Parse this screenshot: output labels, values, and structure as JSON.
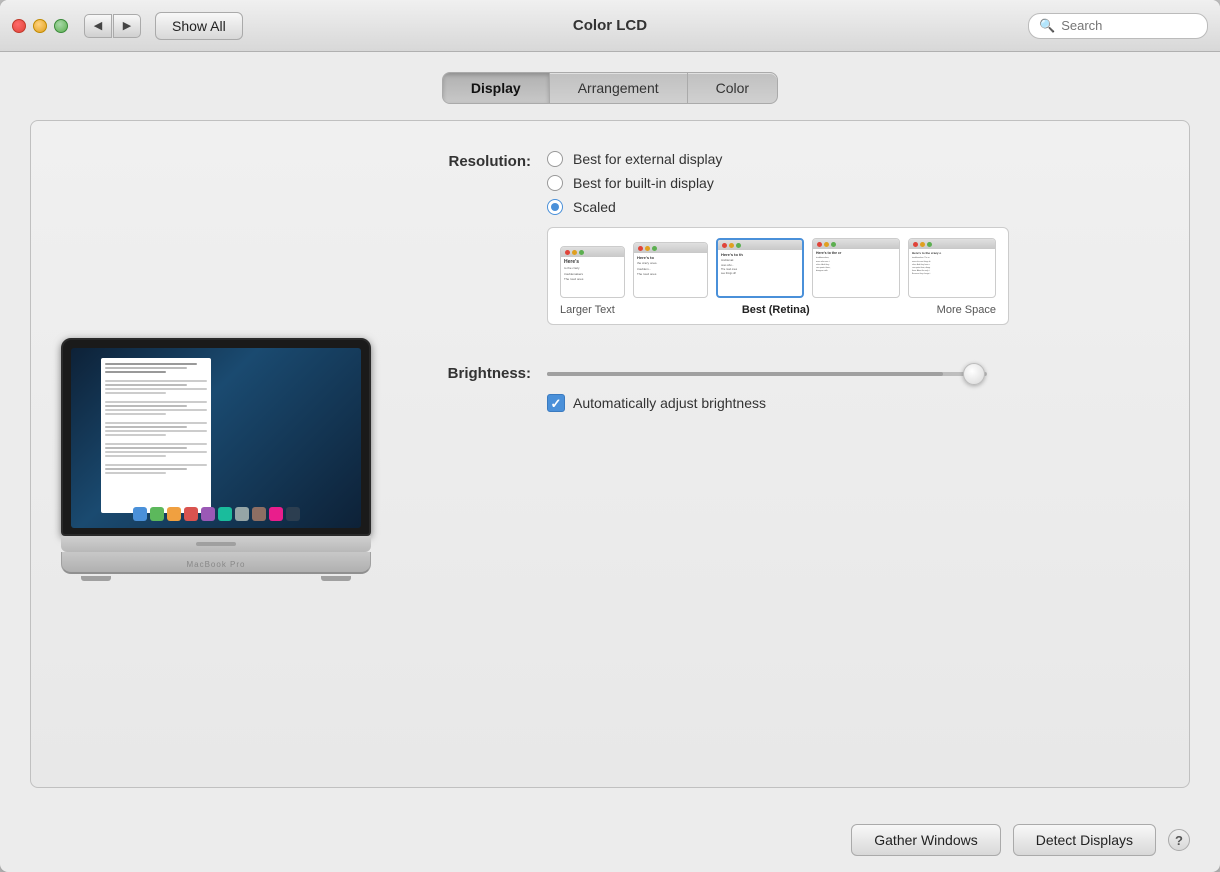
{
  "window": {
    "title": "Color LCD"
  },
  "titlebar": {
    "show_all_label": "Show All",
    "back_icon": "◀",
    "forward_icon": "▶",
    "search_placeholder": "Search"
  },
  "tabs": [
    {
      "id": "display",
      "label": "Display",
      "active": true
    },
    {
      "id": "arrangement",
      "label": "Arrangement",
      "active": false
    },
    {
      "id": "color",
      "label": "Color",
      "active": false
    }
  ],
  "resolution": {
    "label": "Resolution:",
    "options": [
      {
        "id": "best-external",
        "label": "Best for external display",
        "selected": false
      },
      {
        "id": "best-builtin",
        "label": "Best for built-in display",
        "selected": false
      },
      {
        "id": "scaled",
        "label": "Scaled",
        "selected": true
      }
    ],
    "scaled_options": [
      {
        "id": "larger-text",
        "label": "Larger Text",
        "bold": false,
        "selected": false
      },
      {
        "id": "large",
        "label": "",
        "bold": false,
        "selected": false
      },
      {
        "id": "best-retina",
        "label": "Best (Retina)",
        "bold": true,
        "selected": true
      },
      {
        "id": "small",
        "label": "",
        "bold": false,
        "selected": false
      },
      {
        "id": "more-space",
        "label": "More Space",
        "bold": false,
        "selected": false
      }
    ],
    "labels_left": "Larger Text",
    "labels_center": "Best (Retina)",
    "labels_right": "More Space"
  },
  "brightness": {
    "label": "Brightness:",
    "value": 90,
    "auto_label": "Automatically adjust brightness",
    "auto_checked": true
  },
  "buttons": {
    "gather_windows": "Gather Windows",
    "detect_displays": "Detect Displays",
    "help": "?"
  }
}
